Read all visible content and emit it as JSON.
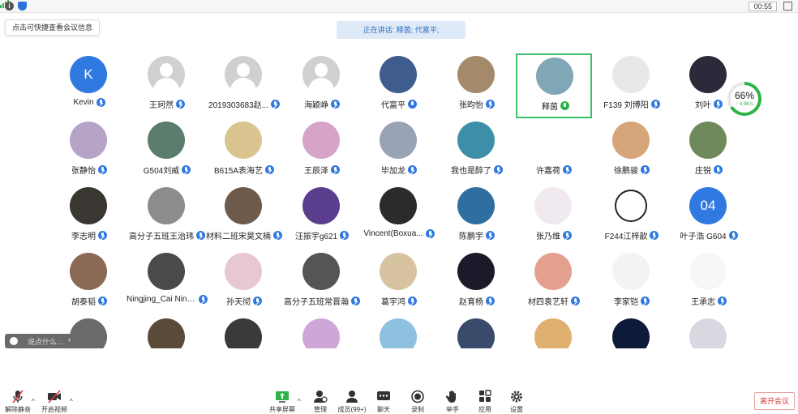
{
  "topbar": {
    "time": "00:55",
    "icons": [
      "info-icon",
      "shield-icon",
      "signal-icon",
      "fullscreen-icon"
    ]
  },
  "meeting_info_tip": "点击可快捷查看会议信息",
  "speaking": "正在讲话: 释茵; 代富平;",
  "participants": [
    {
      "name": "Kevin",
      "avatar": "initial",
      "initial": "K",
      "color": "#2f79e0",
      "mic": "muted"
    },
    {
      "name": "王珂然",
      "avatar": "placeholder",
      "color": "#d0d0d0",
      "mic": "muted"
    },
    {
      "name": "2019303683赵...",
      "avatar": "placeholder",
      "color": "#d0d0d0",
      "mic": "muted"
    },
    {
      "name": "海颖峥",
      "avatar": "placeholder",
      "color": "#d0d0d0",
      "mic": "muted"
    },
    {
      "name": "代富平",
      "avatar": "image",
      "color": "#3f5c8e",
      "mic": "on"
    },
    {
      "name": "张昀怡",
      "avatar": "image",
      "color": "#a48a6a",
      "mic": "muted"
    },
    {
      "name": "释茵",
      "avatar": "image",
      "color": "#7fa7b5",
      "mic": "speaking",
      "active": true
    },
    {
      "name": "F139 刘博阳",
      "avatar": "image",
      "color": "#e8e8e8",
      "mic": "muted"
    },
    {
      "name": "刘叶",
      "avatar": "image",
      "color": "#2a2a3a",
      "mic": "muted"
    },
    {
      "name": "张静怡",
      "avatar": "image",
      "color": "#b7a3c6",
      "mic": "muted"
    },
    {
      "name": "G504刘威",
      "avatar": "image",
      "color": "#5a7d6e",
      "mic": "muted"
    },
    {
      "name": "B615A表海艺",
      "avatar": "image",
      "color": "#d9c48f",
      "mic": "muted"
    },
    {
      "name": "王辰泽",
      "avatar": "image",
      "color": "#d6a3c9",
      "mic": "muted"
    },
    {
      "name": "毕加龙",
      "avatar": "image",
      "color": "#9aa3b5",
      "mic": "muted"
    },
    {
      "name": "我也是醉了",
      "avatar": "image",
      "color": "#3d8fa8",
      "mic": "muted"
    },
    {
      "name": "许嘉荷",
      "avatar": "image",
      "color": "#ffffff",
      "mic": "muted"
    },
    {
      "name": "徐鹏骏",
      "avatar": "image",
      "color": "#d7a57a",
      "mic": "muted"
    },
    {
      "name": "庄锐",
      "avatar": "image",
      "color": "#6f8a5a",
      "mic": "muted"
    },
    {
      "name": "李志明",
      "avatar": "image",
      "color": "#3a3632",
      "mic": "muted"
    },
    {
      "name": "高分子五班王治玮",
      "avatar": "image",
      "color": "#8c8c8c",
      "mic": "muted"
    },
    {
      "name": "材料二班宋昊文楠",
      "avatar": "image",
      "color": "#6d5a4a",
      "mic": "muted"
    },
    {
      "name": "汪振宇g621",
      "avatar": "image",
      "color": "#5b3f8f",
      "mic": "muted"
    },
    {
      "name": "Vincent(Boxua...",
      "avatar": "image",
      "color": "#2b2b2b",
      "mic": "muted"
    },
    {
      "name": "陈鹏宇",
      "avatar": "image",
      "color": "#2f6fa0",
      "mic": "muted"
    },
    {
      "name": "张乃维",
      "avatar": "image",
      "color": "#f0eaf0",
      "mic": "muted"
    },
    {
      "name": "F244江梓歆",
      "avatar": "ring",
      "color": "#ffffff",
      "mic": "muted"
    },
    {
      "name": "叶子浩 G604",
      "avatar": "initial",
      "initial": "04",
      "color": "#2f79e0",
      "mic": "muted"
    },
    {
      "name": "胡泰韬",
      "avatar": "image",
      "color": "#8a6a55",
      "mic": "muted"
    },
    {
      "name": "Ningjing_Cai Ningji...",
      "avatar": "image",
      "color": "#4a4a4a",
      "mic": "muted"
    },
    {
      "name": "孙天彻",
      "avatar": "image",
      "color": "#e8c8d0",
      "mic": "muted"
    },
    {
      "name": "高分子五班常晋瀚",
      "avatar": "image",
      "color": "#555555",
      "mic": "muted"
    },
    {
      "name": "葛宇鸿",
      "avatar": "image",
      "color": "#d7c3a0",
      "mic": "muted"
    },
    {
      "name": "赵育杨",
      "avatar": "image",
      "color": "#1a1a2a",
      "mic": "muted"
    },
    {
      "name": "材四袁艺轩",
      "avatar": "image",
      "color": "#e3a08f",
      "mic": "muted"
    },
    {
      "name": "李家铠",
      "avatar": "image",
      "color": "#f3f3f3",
      "mic": "muted"
    },
    {
      "name": "王承志",
      "avatar": "image",
      "color": "#f7f7f7",
      "mic": "muted"
    },
    {
      "name": "",
      "avatar": "image",
      "color": "#6a6a6a",
      "mic": "none"
    },
    {
      "name": "",
      "avatar": "image",
      "color": "#5a4a3a",
      "mic": "none"
    },
    {
      "name": "",
      "avatar": "image",
      "color": "#3a3a3a",
      "mic": "none"
    },
    {
      "name": "",
      "avatar": "image",
      "color": "#cfa6d8",
      "mic": "none"
    },
    {
      "name": "",
      "avatar": "image",
      "color": "#8ec0e0",
      "mic": "none"
    },
    {
      "name": "",
      "avatar": "image",
      "color": "#3a4a6a",
      "mic": "none"
    },
    {
      "name": "",
      "avatar": "image",
      "color": "#e0b070",
      "mic": "none"
    },
    {
      "name": "",
      "avatar": "image",
      "color": "#0e1a3a",
      "mic": "none"
    },
    {
      "name": "",
      "avatar": "image",
      "color": "#d8d8e0",
      "mic": "none"
    }
  ],
  "network": {
    "percent": "66%",
    "speed": "↑ 4.9K/s"
  },
  "chat": {
    "placeholder": "说点什么..."
  },
  "toolbar": {
    "mute": "解除静音",
    "video": "开启视频",
    "share": "共享屏幕",
    "manage": "管理",
    "members": "成员(99+)",
    "chat": "聊天",
    "record": "录制",
    "raise_hand": "举手",
    "apps": "应用",
    "settings": "设置",
    "leave": "离开会议"
  },
  "colors": {
    "accent": "#2f79e0",
    "active": "#3cc06b",
    "danger": "#d93a3a"
  }
}
